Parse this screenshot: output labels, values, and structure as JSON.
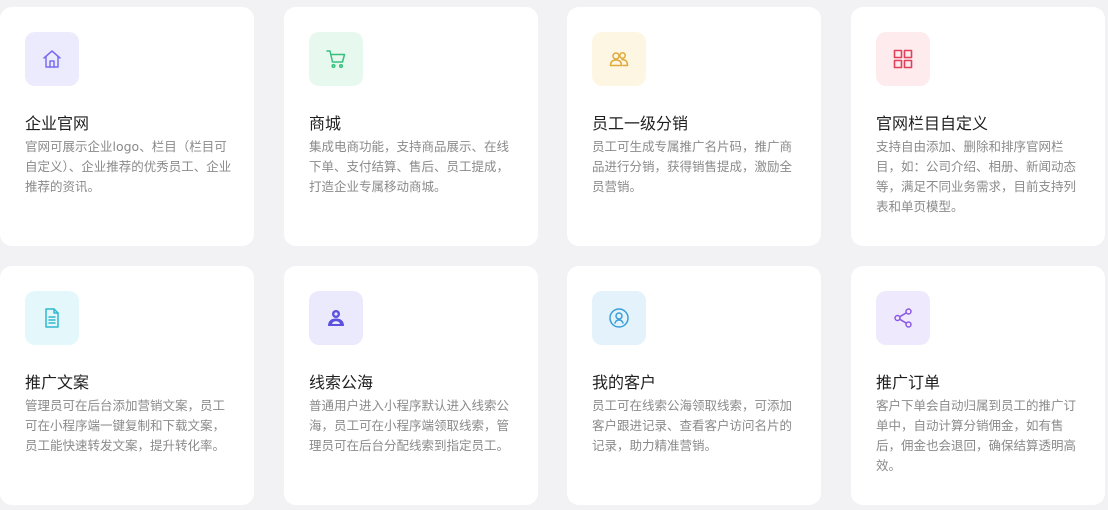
{
  "features": [
    {
      "title": "企业官网",
      "description": "官网可展示企业logo、栏目（栏目可自定义）、企业推荐的优秀员工、企业推荐的资讯。",
      "icon": "home-icon",
      "icon_bg": "#ecebfd",
      "icon_color": "#7a6cf0"
    },
    {
      "title": "商城",
      "description": "集成电商功能，支持商品展示、在线下单、支付结算、售后、员工提成，打造企业专属移动商城。",
      "icon": "cart-icon",
      "icon_bg": "#e7f8ef",
      "icon_color": "#36c07e"
    },
    {
      "title": "员工一级分销",
      "description": "员工可生成专属推广名片码，推广商品进行分销，获得销售提成，激励全员营销。",
      "icon": "users-icon",
      "icon_bg": "#fdf6e3",
      "icon_color": "#e0a93a"
    },
    {
      "title": "官网栏目自定义",
      "description": "支持自由添加、删除和排序官网栏目，如：公司介绍、相册、新闻动态等，满足不同业务需求，目前支持列表和单页模型。",
      "icon": "grid-icon",
      "icon_bg": "#fdebee",
      "icon_color": "#e2415c"
    },
    {
      "title": "推广文案",
      "description": "管理员可在后台添加营销文案，员工可在小程序端一键复制和下载文案，员工能快速转发文案，提升转化率。",
      "icon": "document-icon",
      "icon_bg": "#e4f8fb",
      "icon_color": "#2fb8cf"
    },
    {
      "title": "线索公海",
      "description": "普通用户进入小程序默认进入线索公海，员工可在小程序端领取线索，管理员可在后台分配线索到指定员工。",
      "icon": "user-group-icon",
      "icon_bg": "#ebeafc",
      "icon_color": "#5b50e0"
    },
    {
      "title": "我的客户",
      "description": "员工可在线索公海领取线索，可添加客户跟进记录、查看客户访问名片的记录，助力精准营销。",
      "icon": "user-circle-icon",
      "icon_bg": "#e3f2fb",
      "icon_color": "#3a9fd8"
    },
    {
      "title": "推广订单",
      "description": "客户下单会自动归属到员工的推广订单中，自动计算分销佣金，如有售后，佣金也会退回，确保结算透明高效。",
      "icon": "share-icon",
      "icon_bg": "#efe9fd",
      "icon_color": "#8a5ae6"
    }
  ]
}
